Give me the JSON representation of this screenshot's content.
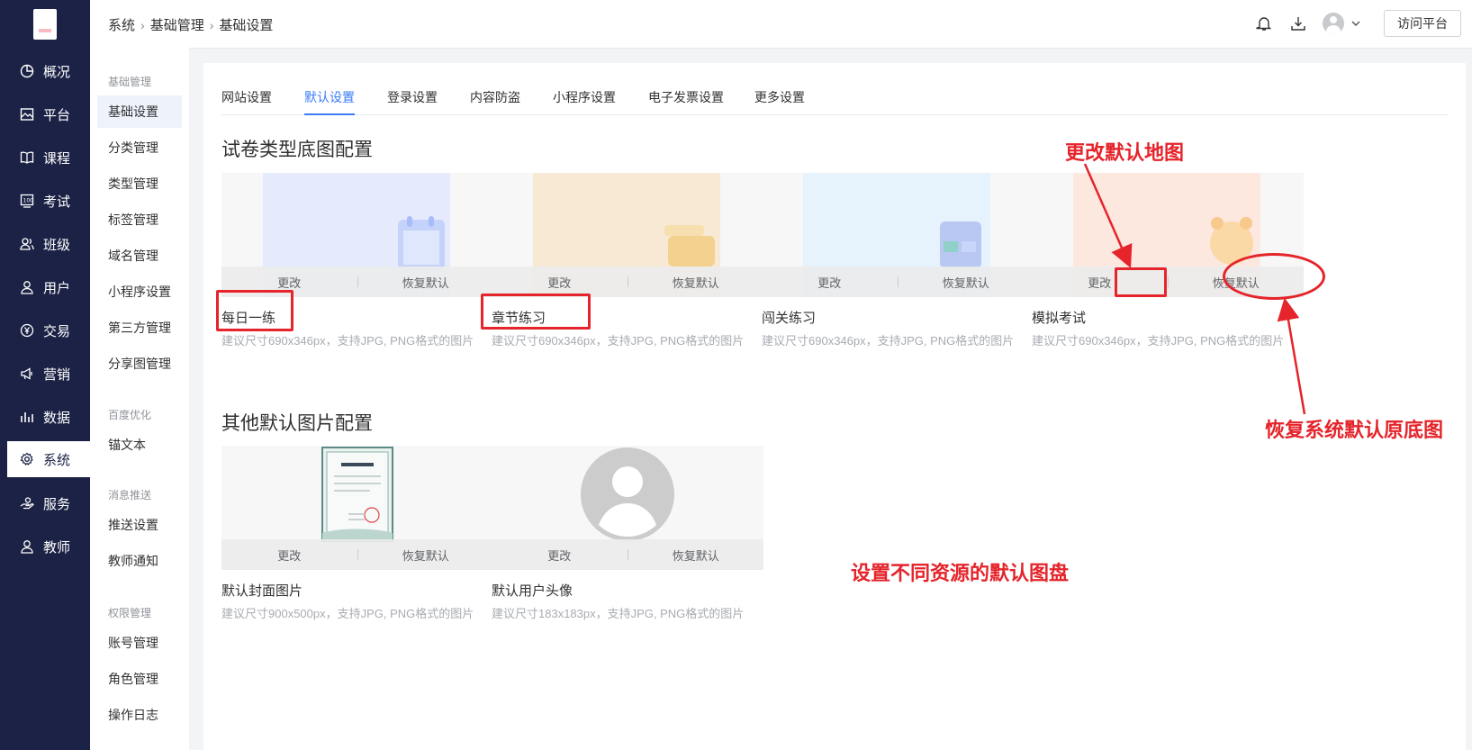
{
  "breadcrumb": [
    "系统",
    "基础管理",
    "基础设置"
  ],
  "header": {
    "visit_label": "访问平台"
  },
  "nav": [
    {
      "label": "概况",
      "icon": "pie-chart-icon"
    },
    {
      "label": "平台",
      "icon": "image-icon"
    },
    {
      "label": "课程",
      "icon": "book-icon"
    },
    {
      "label": "考试",
      "icon": "score-icon"
    },
    {
      "label": "班级",
      "icon": "group-icon"
    },
    {
      "label": "用户",
      "icon": "user-icon"
    },
    {
      "label": "交易",
      "icon": "yen-icon"
    },
    {
      "label": "营销",
      "icon": "megaphone-icon"
    },
    {
      "label": "数据",
      "icon": "bar-chart-icon"
    },
    {
      "label": "系统",
      "icon": "gear-icon",
      "active": true
    },
    {
      "label": "服务",
      "icon": "hand-icon"
    },
    {
      "label": "教师",
      "icon": "teacher-icon"
    }
  ],
  "sub_menu": {
    "groups": [
      {
        "title": "基础管理",
        "items": [
          "基础设置",
          "分类管理",
          "类型管理",
          "标签管理",
          "域名管理",
          "小程序设置",
          "第三方管理",
          "分享图管理"
        ]
      },
      {
        "title": "百度优化",
        "items": [
          "锚文本"
        ]
      },
      {
        "title": "消息推送",
        "items": [
          "推送设置",
          "教师通知"
        ]
      },
      {
        "title": "权限管理",
        "items": [
          "账号管理",
          "角色管理",
          "操作日志"
        ]
      }
    ],
    "active": "基础设置"
  },
  "tabs": [
    "网站设置",
    "默认设置",
    "登录设置",
    "内容防盗",
    "小程序设置",
    "电子发票设置",
    "更多设置"
  ],
  "active_tab": "默认设置",
  "section1": {
    "title": "试卷类型底图配置",
    "cards": [
      {
        "name": "每日一练",
        "hint": "建议尺寸690x346px，支持JPG, PNG格式的图片",
        "change": "更改",
        "restore": "恢复默认",
        "color": "#e5eafd"
      },
      {
        "name": "章节练习",
        "hint": "建议尺寸690x346px，支持JPG, PNG格式的图片",
        "change": "更改",
        "restore": "恢复默认",
        "color": "#f8e9d4"
      },
      {
        "name": "闯关练习",
        "hint": "建议尺寸690x346px，支持JPG, PNG格式的图片",
        "change": "更改",
        "restore": "恢复默认",
        "color": "#e6f2fc"
      },
      {
        "name": "模拟考试",
        "hint": "建议尺寸690x346px，支持JPG, PNG格式的图片",
        "change": "更改",
        "restore": "恢复默认",
        "color": "#fde8e0"
      }
    ]
  },
  "section2": {
    "title": "其他默认图片配置",
    "cards": [
      {
        "name": "默认封面图片",
        "hint": "建议尺寸900x500px，支持JPG, PNG格式的图片",
        "change": "更改",
        "restore": "恢复默认"
      },
      {
        "name": "默认用户头像",
        "hint": "建议尺寸183x183px，支持JPG, PNG格式的图片",
        "change": "更改",
        "restore": "恢复默认"
      }
    ]
  },
  "annotations": {
    "change_note": "更改默认地图",
    "restore_note": "恢复系统默认原底图",
    "set_note": "设置不同资源的默认图盘",
    "color": "#e5242b"
  }
}
